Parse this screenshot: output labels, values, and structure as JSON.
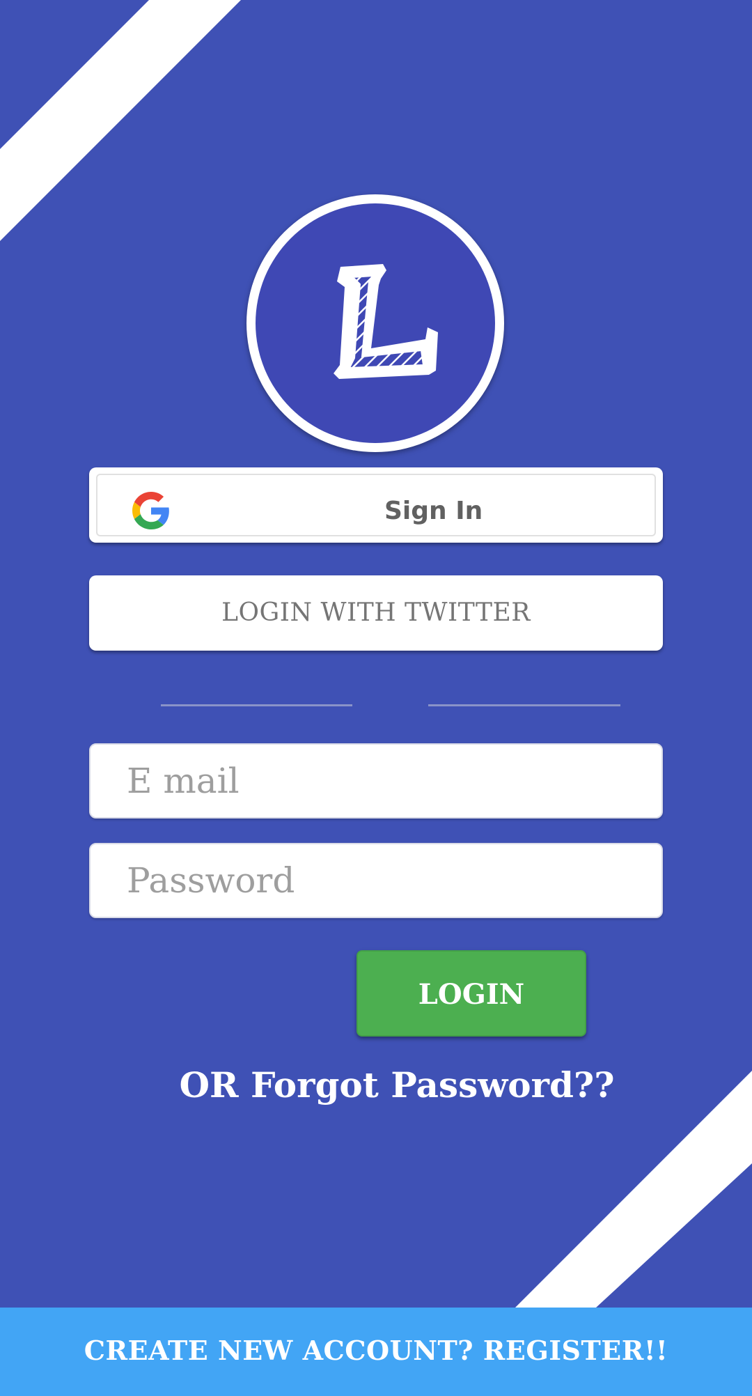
{
  "logo": {
    "letter": "L",
    "icon": "hatched-letter-l-logo"
  },
  "google_signin": {
    "icon": "google-g-icon",
    "label": "Sign In"
  },
  "twitter_login": {
    "label": "LOGIN WITH TWITTER"
  },
  "form": {
    "email_placeholder": "E mail",
    "password_placeholder": "Password",
    "login_label": "LOGIN",
    "forgot_label": "OR Forgot Password??"
  },
  "footer": {
    "register_label": "CREATE NEW ACCOUNT? REGISTER!!"
  },
  "colors": {
    "background": "#3F51B5",
    "login_button": "#4CAF50",
    "register_bar": "#42A5F5"
  }
}
